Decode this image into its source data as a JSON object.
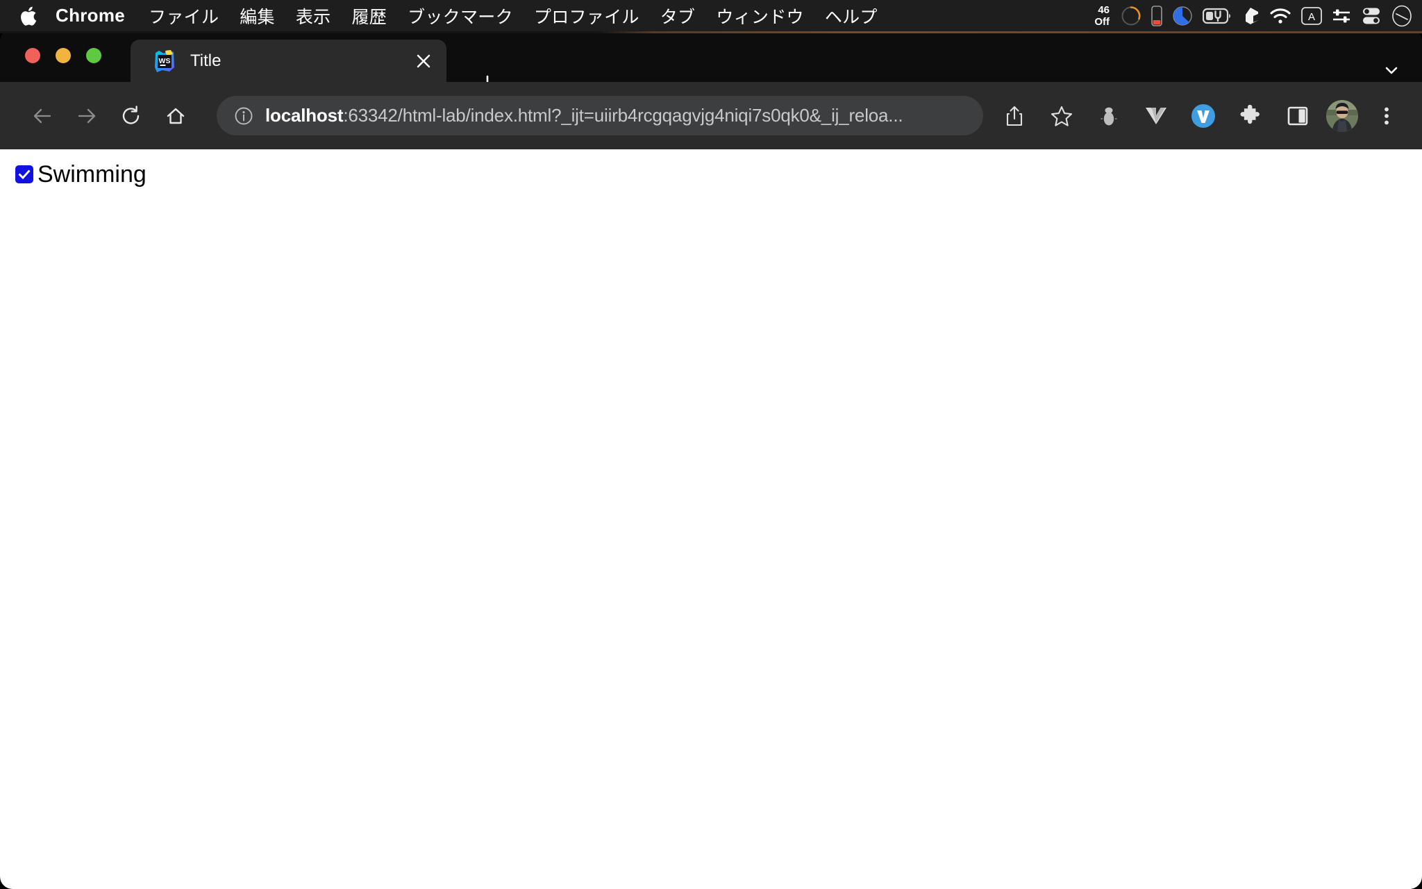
{
  "menubar": {
    "apple_icon": "apple-logo-icon",
    "items": [
      {
        "label": "Chrome",
        "bold": true
      },
      {
        "label": "ファイル",
        "bold": false
      },
      {
        "label": "編集",
        "bold": false
      },
      {
        "label": "表示",
        "bold": false
      },
      {
        "label": "履歴",
        "bold": false
      },
      {
        "label": "ブックマーク",
        "bold": false
      },
      {
        "label": "プロファイル",
        "bold": false
      },
      {
        "label": "タブ",
        "bold": false
      },
      {
        "label": "ウィンドウ",
        "bold": false
      },
      {
        "label": "ヘルプ",
        "bold": false
      }
    ],
    "status": {
      "counter_line1": "46",
      "counter_line2": "Off",
      "icons": [
        "activity-ring-icon",
        "battery-low-indicator-icon",
        "focus-pie-icon",
        "battery-charging-icon",
        "dropbox-icon",
        "wifi-icon",
        "input-source-a-icon",
        "control-sliders-icon",
        "toggle-switches-icon",
        "siri-icon"
      ]
    }
  },
  "browser": {
    "tab": {
      "title": "Title",
      "favicon": "webstorm-icon",
      "close_icon": "close-icon"
    },
    "new_tab_icon": "plus-icon",
    "tab_list_chevron_icon": "chevron-down-icon",
    "window_controls": [
      "close-window-button",
      "minimize-window-button",
      "zoom-window-button"
    ],
    "toolbar": {
      "back_icon": "arrow-left-icon",
      "forward_icon": "arrow-right-icon",
      "reload_icon": "reload-icon",
      "home_icon": "home-icon",
      "site_info_icon": "info-circle-icon",
      "url_host": "localhost",
      "url_rest": ":63342/html-lab/index.html?_ijt=uiirb4rcgqagvjg4niqi7s0qk0&_ij_reloa...",
      "url_full": "localhost:63342/html-lab/index.html?_ijt=uiirb4rcgqagvjg4niqi7s0qk0&_ij_reloa...",
      "share_icon": "share-icon",
      "bookmark_icon": "star-icon",
      "extensions": [
        "mouse-extension-icon",
        "vue-devtools-icon",
        "vimium-icon",
        "puzzle-extensions-icon"
      ],
      "side_panel_icon": "side-panel-icon",
      "avatar_icon": "avatar",
      "menu_icon": "three-dot-menu-icon"
    }
  },
  "page": {
    "checkbox": {
      "label": "Swimming",
      "checked": true,
      "accent_color": "#1111e0",
      "check_icon": "checkmark-icon"
    },
    "background_color": "#ffffff"
  }
}
